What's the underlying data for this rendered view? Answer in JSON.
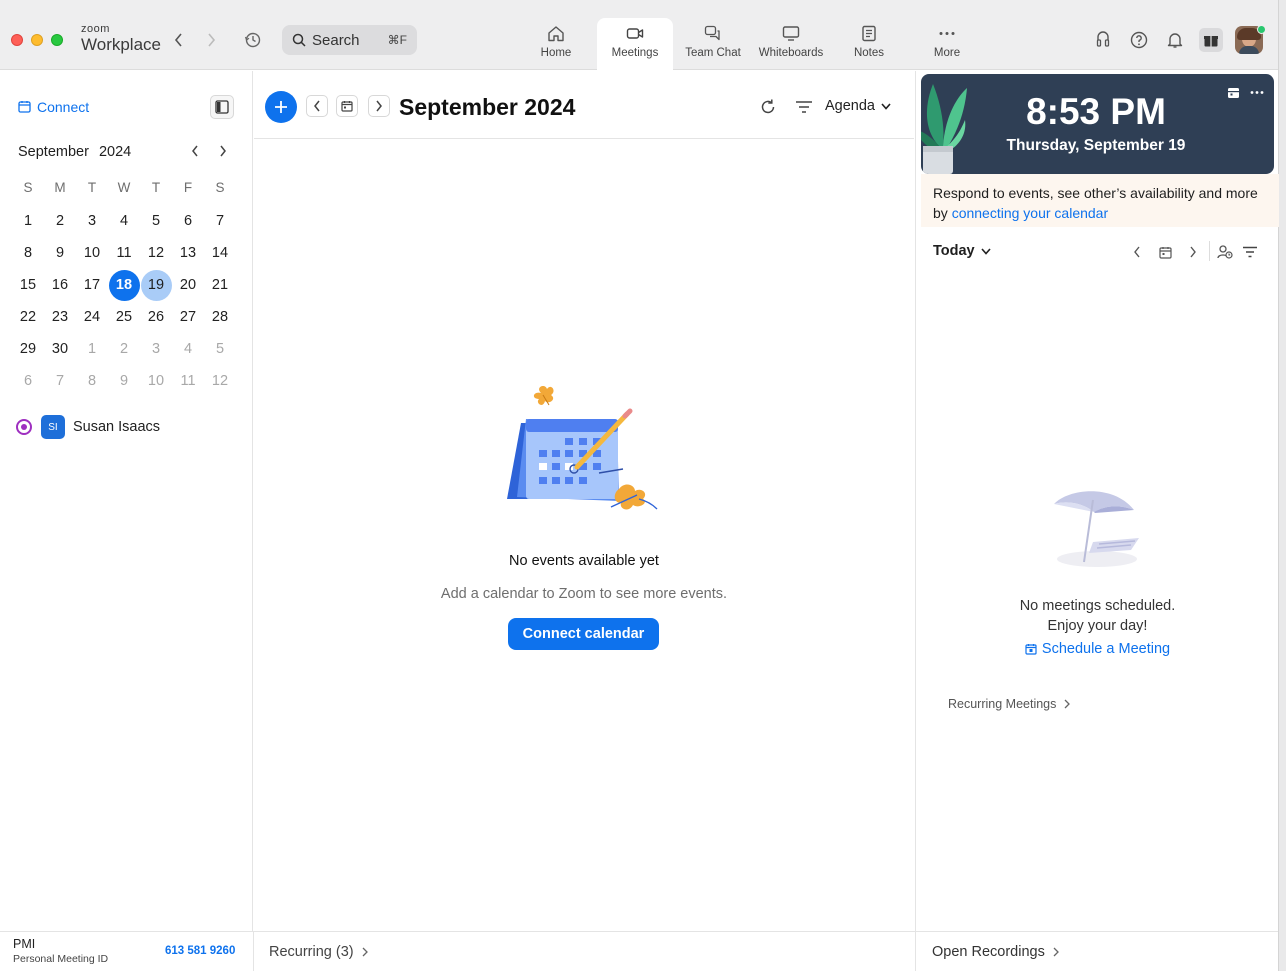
{
  "app": {
    "brand_small": "zoom",
    "brand_large": "Workplace"
  },
  "search": {
    "label": "Search",
    "shortcut": "⌘F"
  },
  "nav_tabs": [
    {
      "label": "Home",
      "icon": "home-icon",
      "active": false
    },
    {
      "label": "Meetings",
      "icon": "video-camera-icon",
      "active": true
    },
    {
      "label": "Team Chat",
      "icon": "chat-bubbles-icon",
      "active": false
    },
    {
      "label": "Whiteboards",
      "icon": "whiteboard-icon",
      "active": false
    },
    {
      "label": "Notes",
      "icon": "notes-icon",
      "active": false
    },
    {
      "label": "More",
      "icon": "more-dots-icon",
      "active": false
    }
  ],
  "sidebar": {
    "connect_label": "Connect",
    "mini_calendar": {
      "month": "September",
      "year": "2024",
      "weekdays": [
        "S",
        "M",
        "T",
        "W",
        "T",
        "F",
        "S"
      ],
      "weeks": [
        [
          "1",
          "2",
          "3",
          "4",
          "5",
          "6",
          "7"
        ],
        [
          "8",
          "9",
          "10",
          "11",
          "12",
          "13",
          "14"
        ],
        [
          "15",
          "16",
          "17",
          "18",
          "19",
          "20",
          "21"
        ],
        [
          "22",
          "23",
          "24",
          "25",
          "26",
          "27",
          "28"
        ],
        [
          "29",
          "30",
          "1",
          "2",
          "3",
          "4",
          "5"
        ],
        [
          "6",
          "7",
          "8",
          "9",
          "10",
          "11",
          "12"
        ]
      ],
      "selected_day": "18",
      "today": "19"
    },
    "person": {
      "initials": "SI",
      "name": "Susan Isaacs"
    }
  },
  "main": {
    "title": "September 2024",
    "view_label": "Agenda",
    "empty_title": "No events available yet",
    "empty_subtitle": "Add a calendar to Zoom to see more events.",
    "connect_button": "Connect calendar"
  },
  "right_panel": {
    "time": "8:53 PM",
    "date": "Thursday, September 19",
    "banner_text": "Respond to events, see other’s availability and more by ",
    "banner_link": "connecting your calendar",
    "today_label": "Today",
    "no_meetings_line1": "No meetings scheduled.",
    "no_meetings_line2": "Enjoy your day!",
    "schedule_link": "Schedule a Meeting",
    "recurring_meetings": "Recurring Meetings"
  },
  "footer": {
    "pmi_label": "PMI",
    "pmi_sub": "Personal Meeting ID",
    "pmi_number": "613 581 9260",
    "recurring": "Recurring (3)",
    "open_recordings": "Open Recordings"
  },
  "colors": {
    "accent": "#0e72ed",
    "today_highlight": "#a9ccf7",
    "hero_bg": "#2f3f55",
    "banner_bg": "#fdf6ef"
  }
}
